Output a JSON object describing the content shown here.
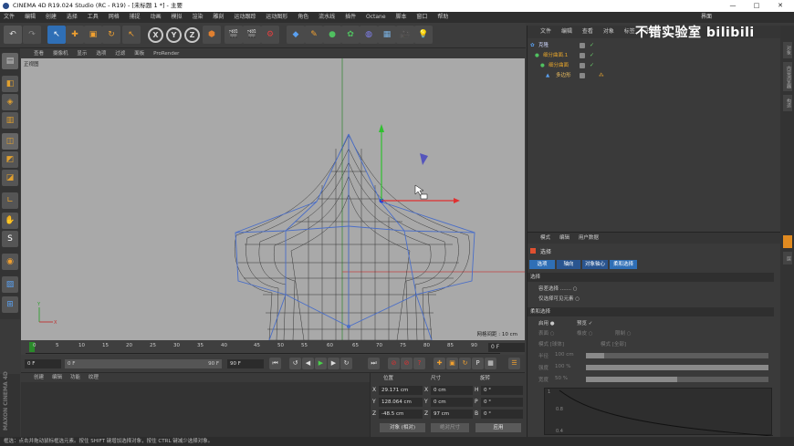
{
  "titlebar": {
    "title": "CINEMA 4D R19.024 Studio (RC - R19) - [未标题 1 *] - 主要",
    "minimize": "—",
    "maximize": "□",
    "close": "✕"
  },
  "menubar": [
    "文件",
    "编辑",
    "创建",
    "选择",
    "工具",
    "网格",
    "捕捉",
    "动画",
    "模拟",
    "渲染",
    "雕刻",
    "运动跟踪",
    "运动图形",
    "角色",
    "流水线",
    "插件",
    "Octane",
    "脚本",
    "窗口",
    "帮助"
  ],
  "layout_label": "界面",
  "viewport": {
    "menu": [
      "查看",
      "摄像机",
      "显示",
      "选项",
      "过滤",
      "面板",
      "ProRender"
    ],
    "view_name": "正视图",
    "grid_info": "网格间距 : 10 cm"
  },
  "timeline": {
    "ticks": [
      "0",
      "5",
      "10",
      "15",
      "20",
      "25",
      "30",
      "35",
      "40",
      "45",
      "50",
      "55",
      "60",
      "65",
      "70",
      "75",
      "80",
      "85",
      "90"
    ],
    "end_field": "0 F",
    "current_frame": 0,
    "total_frames": 90
  },
  "playbar": {
    "start": "0 F",
    "range_start": "0 F",
    "range_end": "90 F",
    "end": "90 F"
  },
  "materials": {
    "menu": [
      "创建",
      "编辑",
      "功能",
      "纹理"
    ]
  },
  "coords": {
    "headers": [
      "位置",
      "尺寸",
      "旋转"
    ],
    "rows": [
      {
        "axis": "X",
        "pos": "29.171 cm",
        "saxis": "X",
        "size": "0 cm",
        "raxis": "H",
        "rot": "0 °"
      },
      {
        "axis": "Y",
        "pos": "128.064 cm",
        "saxis": "Y",
        "size": "0 cm",
        "raxis": "P",
        "rot": "0 °"
      },
      {
        "axis": "Z",
        "pos": "-48.5 cm",
        "saxis": "Z",
        "size": "97 cm",
        "raxis": "B",
        "rot": "0 °"
      }
    ],
    "mode": "对象 (相对)",
    "size_mode": "绝对尺寸",
    "apply": "应用"
  },
  "object_manager": {
    "menu": [
      "文件",
      "编辑",
      "查看",
      "对象",
      "标签",
      "书签"
    ],
    "objects": [
      {
        "name": "克隆",
        "indent": 0
      },
      {
        "name": "细分曲面.1",
        "indent": 1
      },
      {
        "name": "细分曲面",
        "indent": 2
      },
      {
        "name": "多边形",
        "indent": 3
      }
    ]
  },
  "watermark": "不错实验室 bilibili",
  "attributes": {
    "menu": [
      "模式",
      "编辑",
      "用户数据"
    ],
    "title": "选择",
    "tabs": [
      "选项",
      "轴向",
      "对象轴心",
      "柔和选择"
    ],
    "sections": {
      "selection": "选择",
      "soft": "柔和选择"
    },
    "selection_rows": [
      "容差选择 ....... ○",
      "仅选择可见元素 ○"
    ],
    "soft_rows": [
      {
        "label": "启用 ●",
        "extra": "预览 ✓"
      },
      {
        "label": "表面 ○",
        "extra": "橡皮 ○",
        "extra2": "限制 ○"
      },
      {
        "label": "模式 [球体]",
        "extra": "模式 [全部]"
      }
    ],
    "sliders": [
      {
        "label": "半径",
        "value": "100 cm",
        "fill": 0.1
      },
      {
        "label": "强度",
        "value": "100 %",
        "fill": 1.0
      },
      {
        "label": "宽度",
        "value": "50 %",
        "fill": 0.5
      }
    ],
    "graph_labels": [
      "1",
      "0.8",
      "0.4"
    ]
  },
  "right_tabs": [
    "对象",
    "内容浏览器",
    "构造",
    "层"
  ],
  "statusbar": "框选：点击并拖动鼠标框选元素。按住 SHIFT 键增加选择对象，按住 CTRL 键减少选择对象。",
  "maxon": "MAXON CINEMA 4D"
}
